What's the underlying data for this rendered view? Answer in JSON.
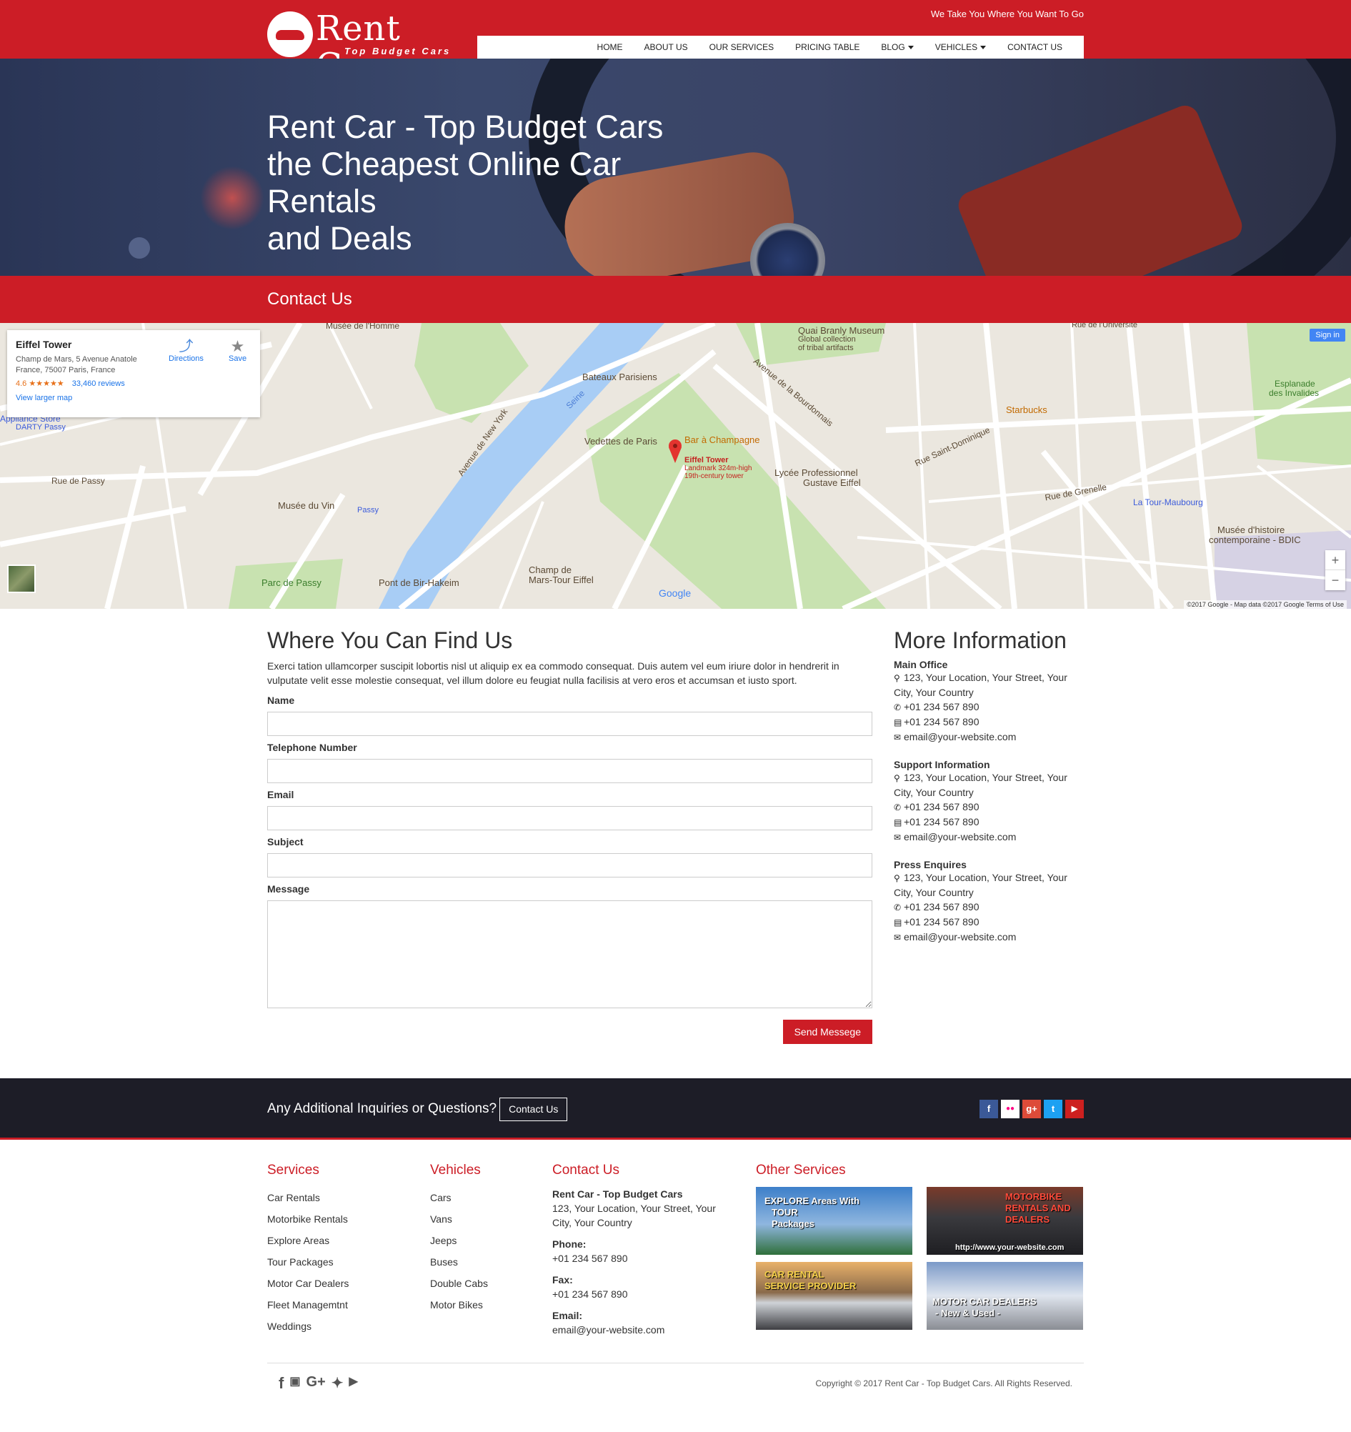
{
  "header": {
    "logo_name": "Rent Car",
    "logo_tagline": "Top Budget Cars",
    "tagline": "We Take You Where You Want To Go",
    "nav": [
      {
        "label": "HOME",
        "dropdown": false
      },
      {
        "label": "ABOUT US",
        "dropdown": false
      },
      {
        "label": "OUR SERVICES",
        "dropdown": false
      },
      {
        "label": "PRICING TABLE",
        "dropdown": false
      },
      {
        "label": "BLOG",
        "dropdown": true
      },
      {
        "label": "VEHICLES",
        "dropdown": true
      },
      {
        "label": "CONTACT US",
        "dropdown": false
      }
    ]
  },
  "hero": {
    "line1": "Rent Car - Top Budget Cars",
    "line2": "the Cheapest Online Car Rentals",
    "line3": "and Deals"
  },
  "contact_bar": {
    "title": "Contact Us"
  },
  "map": {
    "card": {
      "title": "Eiffel Tower",
      "address": "Champ de Mars, 5 Avenue Anatole France, 75007 Paris, France",
      "rating": "4.6",
      "stars": "★★★★★",
      "reviews": "33,460 reviews",
      "larger_map": "View larger map",
      "directions": "Directions",
      "save": "Save"
    },
    "sign_in": "Sign in",
    "zoom_in": "+",
    "zoom_out": "−",
    "attribution": "©2017 Google - Map data ©2017 Google   Terms of Use",
    "labels": {
      "eiffel": "Eiffel Tower",
      "eiffel_sub1": "Landmark 324m-high",
      "eiffel_sub2": "19th-century tower",
      "bar": "Bar à Champagne",
      "vedettes": "Vedettes de Paris",
      "bateaux": "Bateaux Parisiens",
      "quai_branly": "Quai Branly Museum",
      "quai_branly_sub1": "Global collection",
      "quai_branly_sub2": "of tribal artifacts",
      "lycee1": "Lycée Professionnel",
      "lycee2": "Gustave Eiffel",
      "starbucks": "Starbucks",
      "musee_vin": "Musée du Vin",
      "passy": "Passy",
      "parc_passy": "Parc de Passy",
      "bir_hakeim": "Pont de Bir-Hakeim",
      "champ_mars1": "Champ de",
      "champ_mars2": "Mars-Tour Eiffel",
      "tour_maubourg": "La Tour-Maubourg",
      "musee_histoire1": "Musée d'histoire",
      "musee_histoire2": "contemporaine - BDIC",
      "esplanade1": "Esplanade",
      "esplanade2": "des Invalides",
      "musee_homme": "Musée de l'Homme",
      "rue_universite": "Rue de l'Université",
      "appliance1": "Appliance Store",
      "appliance2": "DARTY Passy",
      "seine": "Seine",
      "rue_passy": "Rue de Passy",
      "rue_grenelle": "Rue de Grenelle",
      "rue_st_dominique": "Rue Saint-Dominique",
      "bourdonnais": "Avenue de la Bourdonnais",
      "new_york": "Avenue de New York",
      "google": "Google"
    }
  },
  "find_us": {
    "title": "Where You Can Find Us",
    "intro": "Exerci tation ullamcorper suscipit lobortis nisl ut aliquip ex ea commodo consequat. Duis autem vel eum iriure dolor in hendrerit in vulputate velit esse molestie consequat, vel illum dolore eu feugiat nulla facilisis at vero eros et accumsan et iusto sport.",
    "fields": {
      "name": "Name",
      "telephone": "Telephone Number",
      "email": "Email",
      "subject": "Subject",
      "message": "Message"
    },
    "submit": "Send Messege"
  },
  "more_info": {
    "title": "More Information",
    "blocks": [
      {
        "heading": "Main Office",
        "address": "123, Your Location, Your Street, Your City, Your Country",
        "phone": "+01 234 567 890",
        "fax": "+01 234 567 890",
        "email": "email@your-website.com"
      },
      {
        "heading": "Support Information",
        "address": "123, Your Location, Your Street, Your City, Your Country",
        "phone": "+01 234 567 890",
        "fax": "+01 234 567 890",
        "email": "email@your-website.com"
      },
      {
        "heading": "Press Enquires",
        "address": "123, Your Location, Your Street, Your City, Your Country",
        "phone": "+01 234 567 890",
        "fax": "+01 234 567 890",
        "email": "email@your-website.com"
      }
    ]
  },
  "band": {
    "question": "Any Additional Inquiries or Questions?",
    "button": "Contact Us",
    "social": [
      {
        "icon": "facebook-icon",
        "glyph": "f",
        "color": "#3b5998"
      },
      {
        "icon": "flickr-icon",
        "glyph": "●●",
        "color": "#ffffff"
      },
      {
        "icon": "google-plus-icon",
        "glyph": "g+",
        "color": "#dd4b39"
      },
      {
        "icon": "twitter-icon",
        "glyph": "t",
        "color": "#1da1f2"
      },
      {
        "icon": "youtube-icon",
        "glyph": "▶",
        "color": "#cd201f"
      }
    ]
  },
  "footer": {
    "services": {
      "title": "Services",
      "items": [
        "Car Rentals",
        "Motorbike Rentals",
        "Explore Areas",
        "Tour Packages",
        "Motor Car Dealers",
        "Fleet Managemtnt",
        "Weddings"
      ]
    },
    "vehicles": {
      "title": "Vehicles",
      "items": [
        "Cars",
        "Vans",
        "Jeeps",
        "Buses",
        "Double Cabs",
        "Motor Bikes"
      ]
    },
    "contact": {
      "title": "Contact Us",
      "company": "Rent Car - Top Budget Cars",
      "address": "123, Your Location, Your Street, Your City, Your Country",
      "phone_label": "Phone:",
      "phone": "+01 234 567 890",
      "fax_label": "Fax:",
      "fax": "+01 234 567 890",
      "email_label": "Email:",
      "email": "email@your-website.com"
    },
    "other": {
      "title": "Other Services",
      "tiles": [
        {
          "line1": "EXPLORE Areas With",
          "line2": "TOUR",
          "line3": "Packages"
        },
        {
          "line1": "MOTORBIKE",
          "line2": "RENTALS AND",
          "line3": "DEALERS",
          "line4": "http://www.your-website.com"
        },
        {
          "line1": "CAR RENTAL",
          "line2": "SERVICE PROVIDER"
        },
        {
          "line1": "MOTOR CAR DEALERS",
          "line2": "- New & Used -"
        }
      ]
    },
    "copyright": "Copyright © 2017 Rent Car - Top Budget Cars. All Rights Reserved."
  },
  "colors": {
    "brand_red": "#cc1d26",
    "footer_dark": "#1d1d27"
  }
}
